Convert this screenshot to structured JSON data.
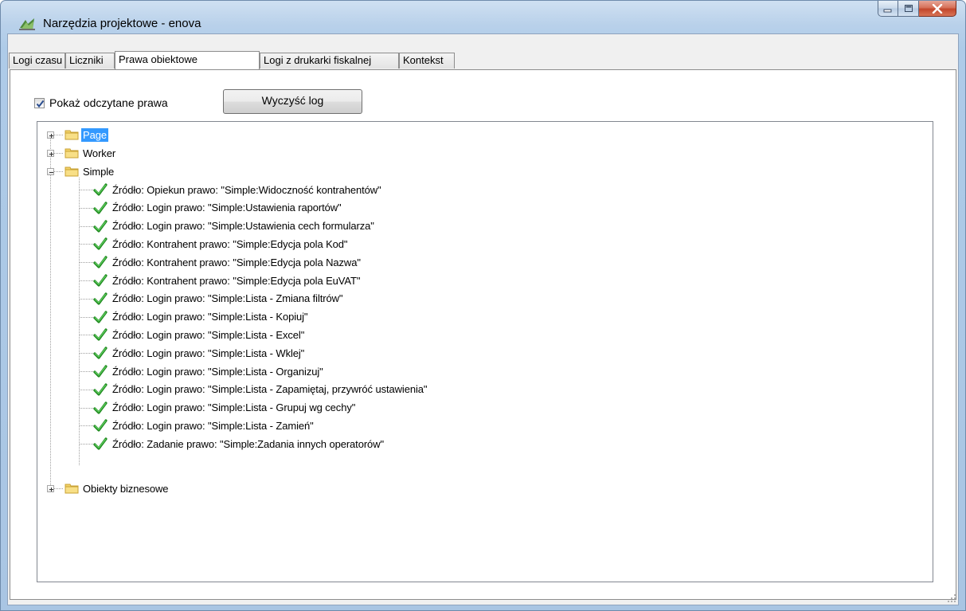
{
  "window": {
    "title": "Narzędzia projektowe - enova"
  },
  "tabs": [
    {
      "label": "Logi czasu",
      "active": false
    },
    {
      "label": "Liczniki",
      "active": false
    },
    {
      "label": "Prawa obiektowe",
      "active": true
    },
    {
      "label": "Logi z drukarki fiskalnej",
      "active": false
    },
    {
      "label": "Kontekst",
      "active": false
    }
  ],
  "options": {
    "show_read_rights_label": "Pokaż odczytane prawa",
    "show_read_rights_checked": true,
    "clear_log_label": "Wyczyść log"
  },
  "tree": {
    "folders": [
      {
        "label": "Page",
        "expanded": false,
        "selected": true
      },
      {
        "label": "Worker",
        "expanded": false,
        "selected": false
      },
      {
        "label": "Simple",
        "expanded": true,
        "selected": false
      },
      {
        "label": "Obiekty biznesowe",
        "expanded": false,
        "selected": false
      }
    ],
    "simple_items": [
      "Źródło: Opiekun prawo: \"Simple:Widoczność kontrahentów\"",
      "Źródło: Login prawo: \"Simple:Ustawienia raportów\"",
      "Źródło: Login prawo: \"Simple:Ustawienia cech formularza\"",
      "Źródło: Kontrahent prawo: \"Simple:Edycja pola Kod\"",
      "Źródło: Kontrahent prawo: \"Simple:Edycja pola Nazwa\"",
      "Źródło: Kontrahent prawo: \"Simple:Edycja pola EuVAT\"",
      "Źródło: Login prawo: \"Simple:Lista - Zmiana filtrów\"",
      "Źródło: Login prawo: \"Simple:Lista - Kopiuj\"",
      "Źródło: Login prawo: \"Simple:Lista - Excel\"",
      "Źródło: Login prawo: \"Simple:Lista - Wklej\"",
      "Źródło: Login prawo: \"Simple:Lista - Organizuj\"",
      "Źródło: Login prawo: \"Simple:Lista - Zapamiętaj, przywróć ustawienia\"",
      "Źródło: Login prawo: \"Simple:Lista - Grupuj wg cechy\"",
      "Źródło: Login prawo: \"Simple:Lista - Zamień\"",
      "Źródło: Zadanie prawo: \"Simple:Zadania innych operatorów\""
    ],
    "item_icon": "green-check-icon",
    "folder_icon": "folder-icon"
  },
  "colors": {
    "selection": "#3399ff",
    "check_green": "#2fa52f",
    "folder_yellow": "#f3d36b"
  }
}
